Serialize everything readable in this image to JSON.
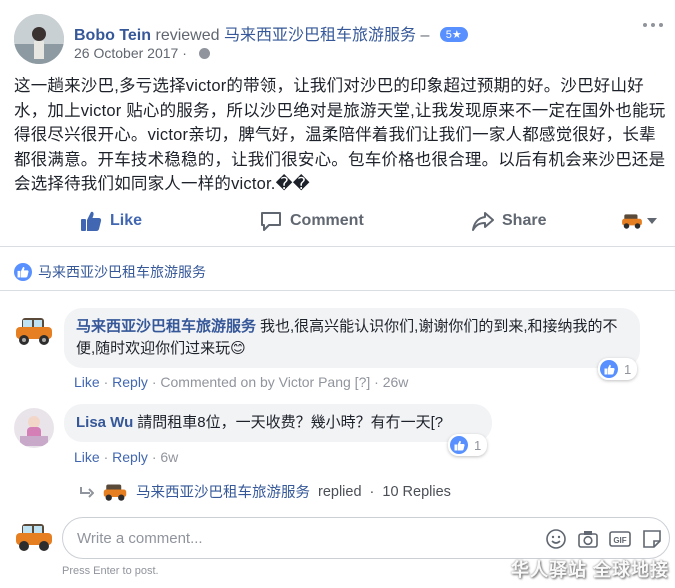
{
  "post": {
    "author": "Bobo Tein",
    "action_word": "reviewed",
    "page_name": "马来西亚沙巴租车旅游服务",
    "dash": "–",
    "rating": "5★",
    "date": "26 October 2017",
    "dot": "·",
    "body": "这一趟来沙巴,多亏选择victor的带领，让我们对沙巴的印象超过预期的好。沙巴好山好水，加上victor 贴心的服务，所以沙巴绝对是旅游天堂,让我发现原来不一定在国外也能玩得很尽兴很开心。victor亲切，脾气好，温柔陪伴着我们让我们一家人都感觉很好，长辈都很满意。开车技术稳稳的，让我们很安心。包车价格也很合理。以后有机会来沙巴还是会选择待我们如同家人一样的victor.��"
  },
  "actions": {
    "like": "Like",
    "comment": "Comment",
    "share": "Share"
  },
  "like_summary": "马来西亚沙巴租车旅游服务",
  "comments": [
    {
      "name": "马来西亚沙巴租车旅游服务",
      "text": "我也,很高兴能认识你们,谢谢你们的到来,和接纳我的不便,随时欢迎你们过来玩",
      "emoji": "😊",
      "like": "Like",
      "reply": "Reply",
      "extra": "Commented on by Victor Pang [?]",
      "time": "26w",
      "reactions": "1"
    },
    {
      "name": "Lisa Wu",
      "text": "請問租車8位，一天收费？幾小時？有冇一天[?",
      "like": "Like",
      "reply": "Reply",
      "time": "6w",
      "reactions": "1"
    }
  ],
  "replies": {
    "name": "马来西亚沙巴租车旅游服务",
    "replied": "replied",
    "sep": "·",
    "count": "10 Replies"
  },
  "composer": {
    "placeholder": "Write a comment...",
    "hint": "Press Enter to post."
  },
  "watermark": "华人驿站 全球地接",
  "colors": {
    "link": "#365899",
    "like_blue": "#4267b2",
    "badge": "#5890ff",
    "bubble": "#f2f3f5"
  }
}
